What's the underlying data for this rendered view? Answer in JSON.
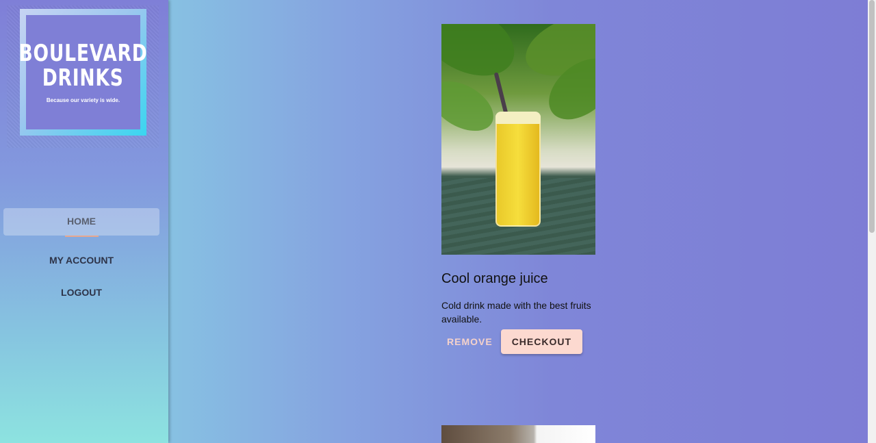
{
  "brand": {
    "line1": "BOULEVARD",
    "line2": "DRINKS",
    "tagline": "Because our variety is wide."
  },
  "nav": {
    "items": [
      {
        "label": "HOME",
        "active": true
      },
      {
        "label": "MY ACCOUNT",
        "active": false
      },
      {
        "label": "LOGOUT",
        "active": false
      }
    ]
  },
  "products": [
    {
      "image": "glass-of-orange-juice-photo",
      "title": "Cool orange juice",
      "description": "Cold drink made with the best fruits available.",
      "actions": {
        "remove": "REMOVE",
        "checkout": "CHECKOUT"
      }
    }
  ],
  "colors": {
    "accent": "#fcd9d0",
    "active_underline": "#e8a78f",
    "sidebar_top": "#7f7fd7",
    "sidebar_bottom": "#8de3e0"
  }
}
